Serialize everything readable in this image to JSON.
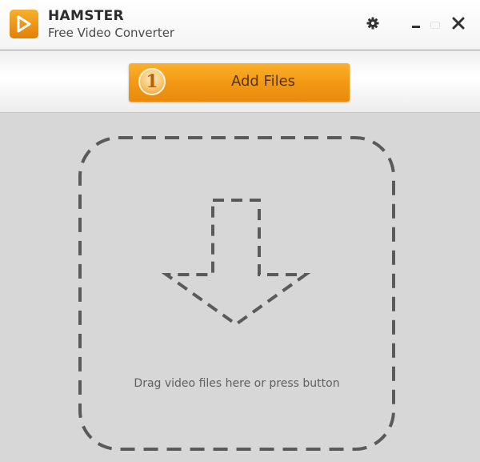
{
  "app": {
    "name": "HAMSTER",
    "subtitle": "Free Video Converter"
  },
  "toolbar": {
    "add_files": {
      "step": "1",
      "label": "Add Files"
    }
  },
  "dropzone": {
    "hint": "Drag video files here or press button"
  },
  "icons": {
    "logo": "play-icon",
    "settings": "gear-icon",
    "minimize": "minimize-icon",
    "close": "close-icon",
    "drop": "arrow-down-icon"
  },
  "colors": {
    "accent": "#f39b16",
    "background": "#d7d7d7",
    "dash": "#5a5a5a"
  }
}
